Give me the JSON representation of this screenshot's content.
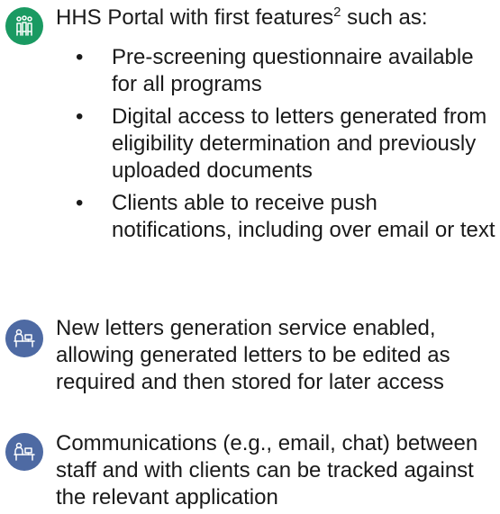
{
  "colors": {
    "portal_icon_bg": "#1a9a62",
    "service_icon_bg": "#4e6aa3",
    "text": "#1a1a1a"
  },
  "sections": [
    {
      "icon": "people-group-icon",
      "title": "HHS  Portal with first features",
      "superscript": "2",
      "title_suffix": " such as:",
      "bullets": [
        "Pre-screening questionnaire available for all programs",
        "Digital access to letters generated from eligibility determination and previously uploaded documents",
        "Clients able to receive push notifications, including over email or text"
      ]
    },
    {
      "icon": "caseworker-desk-icon",
      "text": "New letters generation service enabled, allowing generated letters to be edited as required and then stored for later access"
    },
    {
      "icon": "caseworker-desk-icon",
      "text": "Communications (e.g., email, chat) between staff and with clients can be tracked against the relevant application"
    }
  ]
}
